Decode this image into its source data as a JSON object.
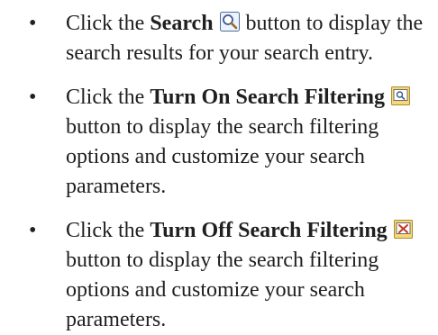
{
  "bullets": [
    {
      "before": "Click the ",
      "bold": "Search",
      "icon": "magnifier-search-icon",
      "after": " button to display the search results for your search entry."
    },
    {
      "before": "Click the ",
      "bold": "Turn On Search Filtering",
      "icon": "search-filter-on-icon",
      "after": " button to display the search filtering options and customize your search parameters."
    },
    {
      "before": "Click the ",
      "bold": "Turn Off Search Filtering",
      "icon": "search-filter-off-icon",
      "after": " button to display the search filtering options and customize your search parameters."
    }
  ]
}
